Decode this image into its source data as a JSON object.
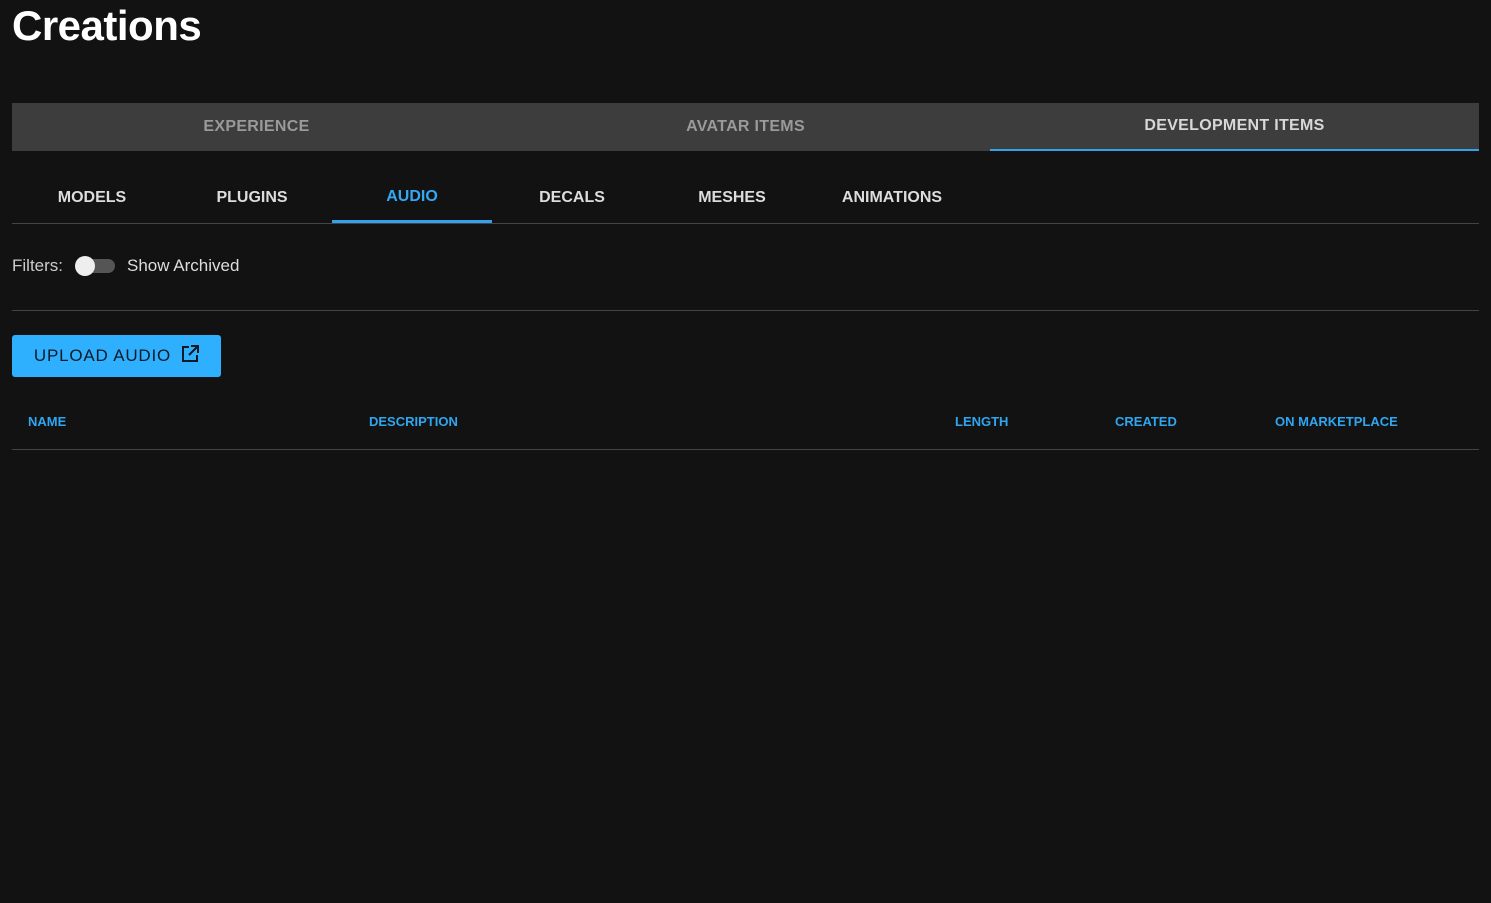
{
  "title": "Creations",
  "main_tabs": [
    {
      "label": "EXPERIENCE"
    },
    {
      "label": "AVATAR ITEMS"
    },
    {
      "label": "DEVELOPMENT ITEMS"
    }
  ],
  "sub_tabs": [
    {
      "label": "MODELS"
    },
    {
      "label": "PLUGINS"
    },
    {
      "label": "AUDIO"
    },
    {
      "label": "DECALS"
    },
    {
      "label": "MESHES"
    },
    {
      "label": "ANIMATIONS"
    }
  ],
  "filters": {
    "label": "Filters:",
    "toggle_label": "Show Archived",
    "show_archived": false
  },
  "upload_button": "UPLOAD AUDIO",
  "table": {
    "columns": [
      "NAME",
      "DESCRIPTION",
      "LENGTH",
      "CREATED",
      "ON MARKETPLACE"
    ]
  },
  "colors": {
    "accent": "#33a1eb",
    "button": "#2fb0ff"
  }
}
